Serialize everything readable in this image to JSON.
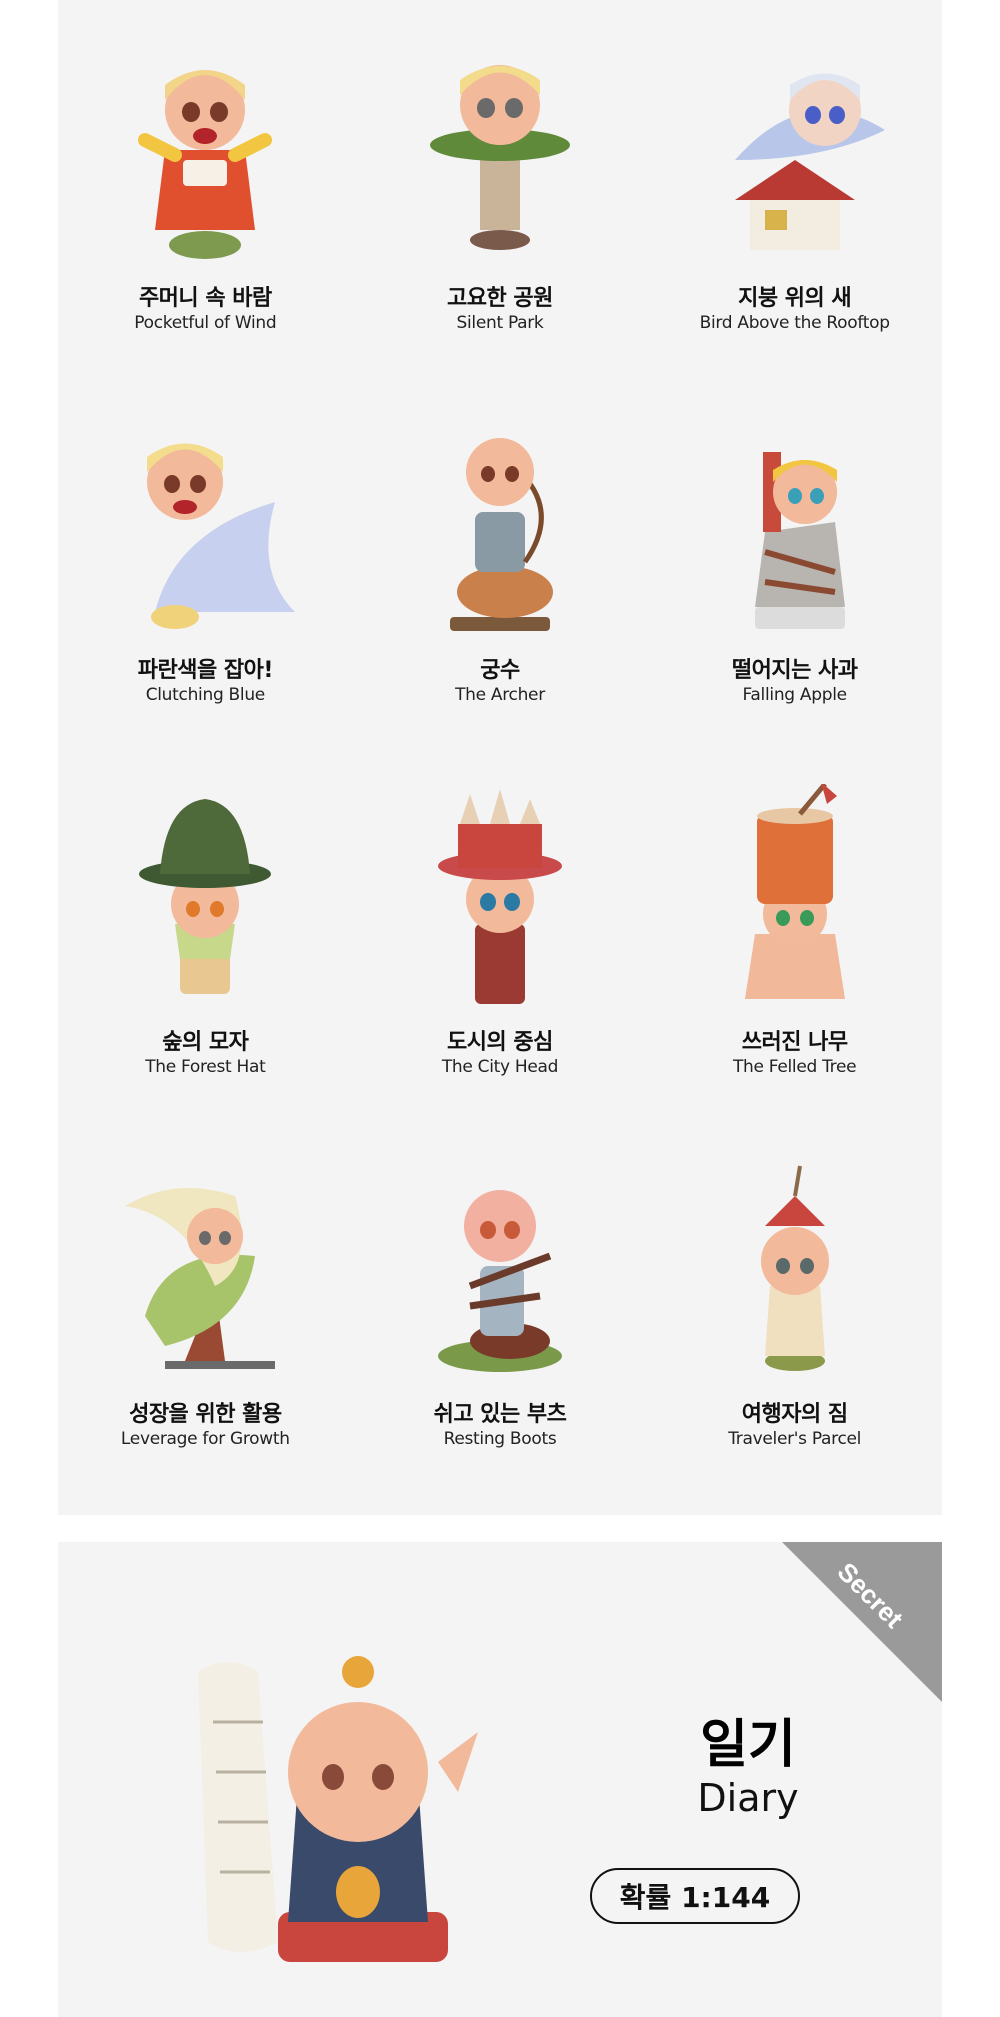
{
  "figures": [
    {
      "ko": "주머니 속 바람",
      "en": "Pocketful of Wind"
    },
    {
      "ko": "고요한 공원",
      "en": "Silent Park"
    },
    {
      "ko": "지붕 위의 새",
      "en": "Bird Above the Rooftop"
    },
    {
      "ko": "파란색을 잡아!",
      "en": "Clutching Blue"
    },
    {
      "ko": "궁수",
      "en": "The Archer"
    },
    {
      "ko": "떨어지는 사과",
      "en": "Falling Apple"
    },
    {
      "ko": "숲의 모자",
      "en": "The Forest Hat"
    },
    {
      "ko": "도시의 중심",
      "en": "The City Head"
    },
    {
      "ko": "쓰러진 나무",
      "en": "The Felled Tree"
    },
    {
      "ko": "성장을 위한 활용",
      "en": "Leverage for Growth"
    },
    {
      "ko": "쉬고 있는 부츠",
      "en": "Resting Boots"
    },
    {
      "ko": "여행자의 짐",
      "en": "Traveler's Parcel"
    }
  ],
  "secret": {
    "badge": "Secret",
    "ko": "일기",
    "en": "Diary",
    "odds": "확률 1:144"
  },
  "colors": {
    "panel_bg": "#f4f4f5",
    "ribbon": "#9a9a9a",
    "skin": "#f2b99a"
  }
}
